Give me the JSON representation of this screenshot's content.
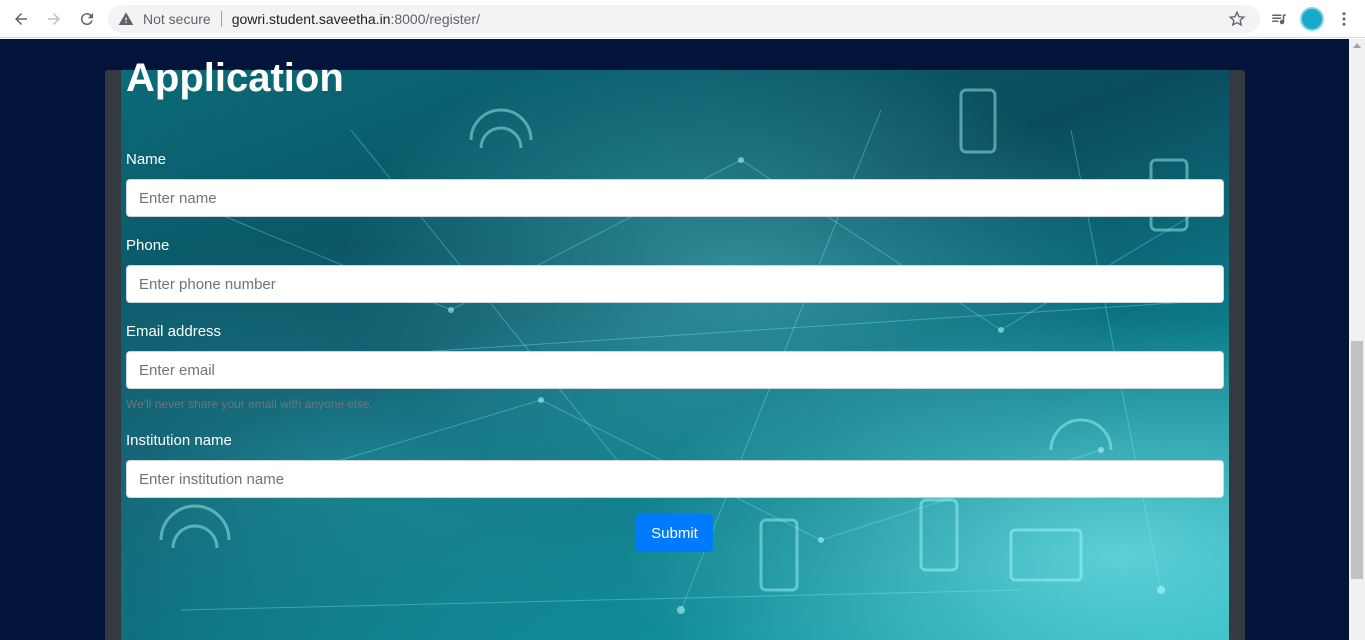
{
  "browser": {
    "security_label": "Not secure",
    "url_host": "gowri.student.saveetha.in",
    "url_path": ":8000/register/"
  },
  "form": {
    "title": "Application",
    "name_label": "Name",
    "name_placeholder": "Enter name",
    "phone_label": "Phone",
    "phone_placeholder": "Enter phone number",
    "email_label": "Email address",
    "email_placeholder": "Enter email",
    "email_help": "We'll never share your email with anyone else.",
    "institution_label": "Institution name",
    "institution_placeholder": "Enter institution name",
    "submit_label": "Submit"
  },
  "colors": {
    "page_background": "#03143a",
    "frame": "#343a40",
    "primary_button": "#007bff"
  }
}
